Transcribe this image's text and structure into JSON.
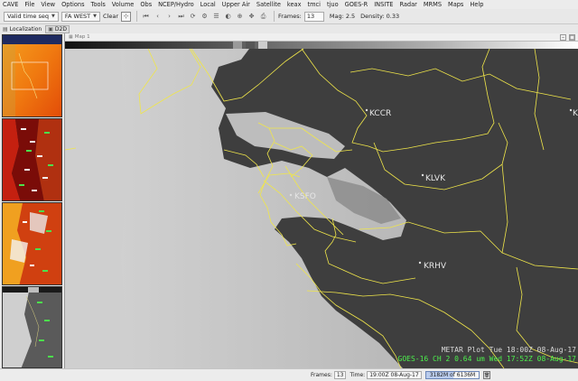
{
  "menubar": {
    "items": [
      "CAVE",
      "File",
      "View",
      "Options",
      "Tools",
      "Volume",
      "Obs",
      "NCEP/Hydro",
      "Local",
      "Upper Air",
      "Satellite",
      "keax",
      "tmci",
      "tjuo",
      "GOES-R",
      "INSITE",
      "Radar",
      "MRMS",
      "Maps",
      "Help"
    ]
  },
  "toolbar": {
    "time_mode": "Valid time seq",
    "scale": "FA WEST",
    "clear_label": "Clear",
    "frames_label": "Frames:",
    "frames_value": "13",
    "mag_label": "Mag: 2.5",
    "density_label": "Density: 0.33"
  },
  "tabs": {
    "localization": "Localization",
    "d2d": "D2D"
  },
  "map_editor": {
    "tab_label": "Map 1"
  },
  "map": {
    "stations": [
      {
        "id": "KCCR"
      },
      {
        "id": "KLVK"
      },
      {
        "id": "KSFO"
      },
      {
        "id": "KRHV"
      },
      {
        "id": "K"
      }
    ],
    "legend": {
      "line1": "METAR Plot  Tue 18:00Z 08-Aug-17",
      "line2": "GOES-16 CH 2  0.64 um  Wed 17:52Z 08-Aug-17"
    },
    "colors": {
      "map_overlay": "#f0e64a",
      "legend_metar": "#d8d8d8",
      "legend_goes": "#4cf04c"
    }
  },
  "status": {
    "frames_label": "Frames:",
    "frames_value": "13",
    "time_label": "Time:",
    "time_value": "19:00Z 08-Aug-17",
    "memory": "3182M of 6136M"
  }
}
